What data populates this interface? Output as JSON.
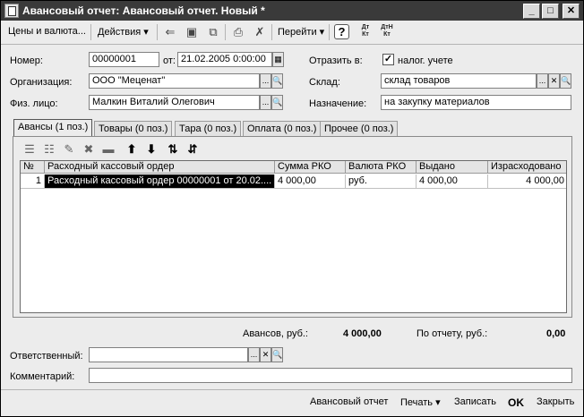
{
  "window": {
    "title": "Авансовый отчет: Авансовый отчет. Новый *",
    "min_glyph": "_",
    "max_glyph": "□",
    "close_glyph": "✕"
  },
  "toolbar": {
    "prices_currency": "Цены и валюта...",
    "actions": "Действия ▾",
    "goto": "Перейти ▾",
    "help": "?",
    "dt_kt_top": "Дт",
    "dt_kt_bottom": "Кт",
    "dtn_kt_top": "ДтН",
    "dtn_kt_bottom": "Кт"
  },
  "header": {
    "number_label": "Номер:",
    "number_value": "00000001",
    "date_label": "от:",
    "date_value": "21.02.2005  0:00:00",
    "reflect_label": "Отразить в:",
    "tax_checkbox_mark": "✓",
    "tax_checkbox_label": "налог. учете",
    "org_label": "Организация:",
    "org_value": "ООО \"Меценат\"",
    "warehouse_label": "Склад:",
    "warehouse_value": "склад товаров",
    "person_label": "Физ. лицо:",
    "person_value": "Малкин Виталий Олегович",
    "purpose_label": "Назначение:",
    "purpose_value": "на закупку материалов",
    "select_glyph": "...",
    "search_glyph": "🔍",
    "clear_glyph": "✕"
  },
  "tabs": [
    {
      "label": "Авансы (1 поз.)"
    },
    {
      "label": "Товары (0 поз.)"
    },
    {
      "label": "Тара (0 поз.)"
    },
    {
      "label": "Оплата (0 поз.)"
    },
    {
      "label": "Прочее (0 поз.)"
    }
  ],
  "grid": {
    "columns": [
      "№",
      "Расходный кассовый ордер",
      "Сумма РКО",
      "Валюта РКО",
      "Выдано",
      "Израсходовано"
    ],
    "rows": [
      {
        "n": "1",
        "order": "Расходный кассовый ордер 00000001 от 20.02....",
        "sum": "4 000,00",
        "currency": "руб.",
        "issued": "4 000,00",
        "spent": "4 000,00"
      }
    ]
  },
  "totals": {
    "advances_label": "Авансов, руб.:",
    "advances_value": "4 000,00",
    "report_label": "По отчету, руб.:",
    "report_value": "0,00"
  },
  "footer_fields": {
    "responsible_label": "Ответственный:",
    "responsible_value": "",
    "comment_label": "Комментарий:",
    "comment_value": ""
  },
  "bottom": {
    "advance_report": "Авансовый отчет",
    "print": "Печать ▾",
    "save": "Записать",
    "ok": "OK",
    "close": "Закрыть"
  }
}
